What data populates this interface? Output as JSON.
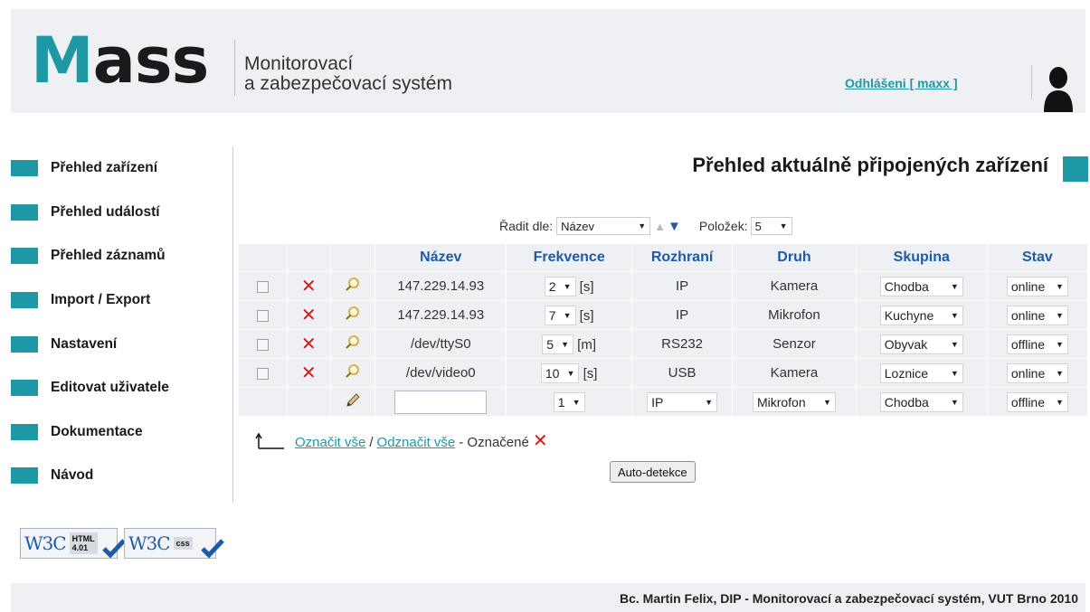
{
  "header": {
    "logo": {
      "first_letter": "M",
      "rest": "ass"
    },
    "subtitle_line1": "Monitorovací",
    "subtitle_line2": "a zabezpečovací systém",
    "logout_link": "Odhlášeni [ maxx ]"
  },
  "colors": {
    "accent": "#1f98a6",
    "link_blue": "#1d5aa8",
    "panel_bg": "#eef0f4",
    "delete_red": "#d21a1a"
  },
  "sidebar": {
    "items": [
      {
        "label": "Přehled zařízení"
      },
      {
        "label": "Přehled událostí"
      },
      {
        "label": "Přehled záznamů"
      },
      {
        "label": "Import / Export"
      },
      {
        "label": "Nastavení"
      },
      {
        "label": "Editovat uživatele"
      },
      {
        "label": "Dokumentace"
      },
      {
        "label": "Návod"
      }
    ],
    "badges": [
      {
        "logo": "W3C",
        "tag_line1": "HTML",
        "tag_line2": "4.01"
      },
      {
        "logo": "W3C",
        "tag_line1": "css",
        "tag_line2": ""
      }
    ]
  },
  "main": {
    "title": "Přehled aktuálně připojených zařízení",
    "sort": {
      "label": "Řadit dle:",
      "value": "Název",
      "count_label": "Položek:",
      "count_value": "5"
    },
    "table": {
      "columns": [
        "Název",
        "Frekvence",
        "Rozhraní",
        "Druh",
        "Skupina",
        "Stav"
      ],
      "rows": [
        {
          "name": "147.229.14.93",
          "freq": "2",
          "unit": "[s]",
          "iface": "IP",
          "kind": "Kamera",
          "group": "Chodba",
          "state": "online"
        },
        {
          "name": "147.229.14.93",
          "freq": "7",
          "unit": "[s]",
          "iface": "IP",
          "kind": "Mikrofon",
          "group": "Kuchyne",
          "state": "online"
        },
        {
          "name": "/dev/ttyS0",
          "freq": "5",
          "unit": "[m]",
          "iface": "RS232",
          "kind": "Senzor",
          "group": "Obyvak",
          "state": "offline"
        },
        {
          "name": "/dev/video0",
          "freq": "10",
          "unit": "[s]",
          "iface": "USB",
          "kind": "Kamera",
          "group": "Loznice",
          "state": "online"
        }
      ],
      "new_row": {
        "freq": "1",
        "iface": "IP",
        "kind": "Mikrofon",
        "group": "Chodba",
        "state": "offline"
      }
    },
    "select_all": "Označit vše",
    "separator": "/",
    "deselect_all": "Odznačit vše",
    "marked_label": "- Označené",
    "autodetect_button": "Auto-detekce"
  },
  "footer": {
    "text": "Bc. Martin Felix, DIP - Monitorovací a zabezpečovací systém, VUT Brno 2010"
  }
}
